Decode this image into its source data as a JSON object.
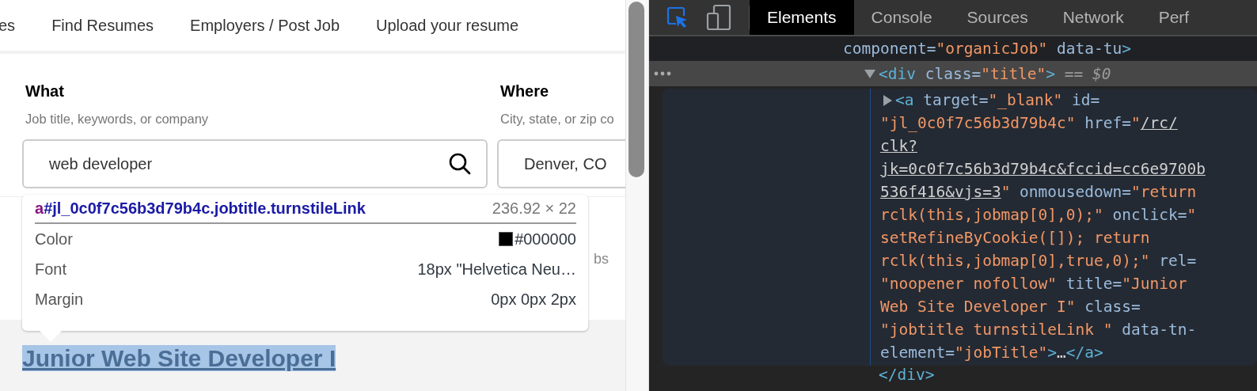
{
  "page": {
    "nav": [
      "es",
      "Find Resumes",
      "Employers / Post Job",
      "Upload your resume"
    ],
    "what": {
      "label": "What",
      "hint": "Job title, keywords, or company",
      "value": "web developer"
    },
    "where": {
      "label": "Where",
      "hint": "City, state, or zip co",
      "value": "Denver, CO"
    },
    "partial_text": "bs",
    "job_title": "Junior Web Site Developer I"
  },
  "tooltip": {
    "tag": "a",
    "selector": "#jl_0c0f7c56b3d79b4c.jobtitle.turnstileLink",
    "size": "236.92 × 22",
    "properties": [
      {
        "name": "Color",
        "value": "#000000",
        "color": "#000000"
      },
      {
        "name": "Font",
        "value": "18px \"Helvetica Neu…"
      },
      {
        "name": "Margin",
        "value": "0px 0px 2px"
      }
    ]
  },
  "devtools": {
    "tabs": [
      {
        "label": "Elements",
        "selected": true
      },
      {
        "label": "Console",
        "selected": false
      },
      {
        "label": "Sources",
        "selected": false
      },
      {
        "label": "Network",
        "selected": false
      },
      {
        "label": "Perf",
        "selected": false
      }
    ],
    "lines": [
      {
        "kind": "context",
        "segments": [
          {
            "kind": "attr",
            "text": "component="
          },
          {
            "kind": "value",
            "text": "\"organicJob\""
          },
          {
            "kind": "attr",
            "text": " data-tu"
          },
          {
            "kind": "tag",
            "text": ">"
          }
        ]
      },
      {
        "kind": "node",
        "selected": true,
        "expanded": true,
        "segments": [
          {
            "kind": "tag",
            "text": "<div"
          },
          {
            "kind": "attr",
            "text": " class="
          },
          {
            "kind": "value",
            "text": "\"title\""
          },
          {
            "kind": "tag",
            "text": ">"
          },
          {
            "kind": "muted",
            "text": " == "
          },
          {
            "kind": "var",
            "text": "$0"
          }
        ]
      },
      {
        "kind": "child",
        "expanded": false,
        "segments": [
          {
            "kind": "tag",
            "text": "<a"
          },
          {
            "kind": "attr",
            "text": " target="
          },
          {
            "kind": "value",
            "text": "\"_blank\""
          },
          {
            "kind": "attr",
            "text": " id="
          }
        ]
      },
      {
        "kind": "wrap",
        "segments": [
          {
            "kind": "value",
            "text": "\"jl_0c0f7c56b3d79b4c\""
          },
          {
            "kind": "attr",
            "text": " href="
          },
          {
            "kind": "value",
            "text": "\""
          },
          {
            "kind": "link",
            "text": "/rc/"
          }
        ]
      },
      {
        "kind": "wrap",
        "segments": [
          {
            "kind": "link",
            "text": "clk?"
          }
        ]
      },
      {
        "kind": "wrap",
        "segments": [
          {
            "kind": "link",
            "text": "jk=0c0f7c56b3d79b4c&fccid=cc6e9700b"
          }
        ]
      },
      {
        "kind": "wrap",
        "segments": [
          {
            "kind": "link",
            "text": "536f416&vjs=3"
          },
          {
            "kind": "value",
            "text": "\""
          },
          {
            "kind": "attr",
            "text": " onmousedown="
          },
          {
            "kind": "value",
            "text": "\"return"
          }
        ]
      },
      {
        "kind": "wrap",
        "segments": [
          {
            "kind": "value",
            "text": "rclk(this,jobmap[0],0);\""
          },
          {
            "kind": "attr",
            "text": " onclick="
          },
          {
            "kind": "value",
            "text": "\""
          }
        ]
      },
      {
        "kind": "wrap",
        "segments": [
          {
            "kind": "value",
            "text": "setRefineByCookie([]); return"
          }
        ]
      },
      {
        "kind": "wrap",
        "segments": [
          {
            "kind": "value",
            "text": "rclk(this,jobmap[0],true,0);\""
          },
          {
            "kind": "attr",
            "text": " rel="
          }
        ]
      },
      {
        "kind": "wrap",
        "segments": [
          {
            "kind": "value",
            "text": "\"noopener nofollow\""
          },
          {
            "kind": "attr",
            "text": " title="
          },
          {
            "kind": "value",
            "text": "\"Junior"
          }
        ]
      },
      {
        "kind": "wrap",
        "segments": [
          {
            "kind": "value",
            "text": "Web Site Developer I\""
          },
          {
            "kind": "attr",
            "text": " class="
          }
        ]
      },
      {
        "kind": "wrap",
        "segments": [
          {
            "kind": "value",
            "text": "\"jobtitle turnstileLink \""
          },
          {
            "kind": "attr",
            "text": " data-tn-"
          }
        ]
      },
      {
        "kind": "wrap",
        "segments": [
          {
            "kind": "attr",
            "text": "element="
          },
          {
            "kind": "value",
            "text": "\"jobTitle\""
          },
          {
            "kind": "tag",
            "text": ">"
          },
          {
            "kind": "plain",
            "text": "…"
          },
          {
            "kind": "tag",
            "text": "</a>"
          }
        ]
      },
      {
        "kind": "closing",
        "segments": [
          {
            "kind": "tag",
            "text": "</div>"
          }
        ]
      }
    ]
  }
}
